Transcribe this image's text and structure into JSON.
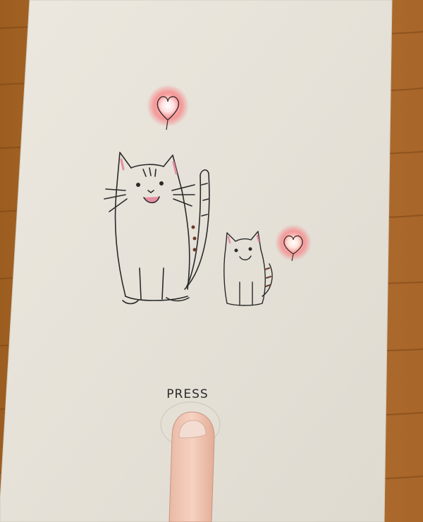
{
  "card": {
    "button_label": "PRESS"
  },
  "leds": [
    {
      "name": "heart-led-left",
      "lit": true,
      "color": "#ff4a52"
    },
    {
      "name": "heart-led-right",
      "lit": true,
      "color": "#ff4a52"
    }
  ],
  "colors": {
    "wood": "#b8742c",
    "wood_dark": "#8a4f17",
    "paper": "#e9e5dc",
    "ink": "#2a2a2a",
    "cheek": "#e58ea0",
    "led_glow": "#ff5a62",
    "skin": "#f0c7b3"
  },
  "illustration": {
    "subjects": [
      "large-cat-drawing",
      "small-cat-drawing"
    ]
  }
}
